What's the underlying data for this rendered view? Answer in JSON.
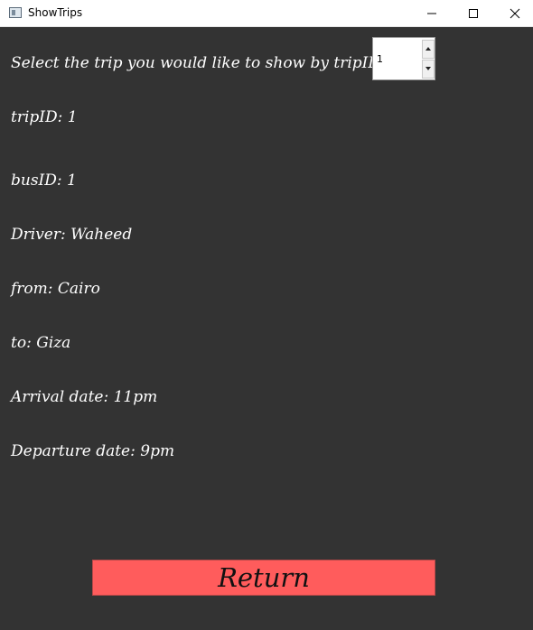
{
  "window": {
    "title": "ShowTrips",
    "icon": "app-window-icon",
    "controls": [
      "minimize-icon",
      "maximize-icon",
      "close-icon"
    ]
  },
  "selector": {
    "prompt": "Select the trip you would like to show by tripID",
    "value": "1"
  },
  "trip": {
    "tripID": "tripID: 1",
    "busID": "busID: 1",
    "driver": "Driver: Waheed",
    "from": "from: Cairo",
    "to": "to: Giza",
    "arrival": "Arrival date: 11pm",
    "departure": "Departure date: 9pm"
  },
  "actions": {
    "return_label": "Return"
  },
  "colors": {
    "background": "#333333",
    "text": "#ffffff",
    "return_button": "#ff5c5c"
  }
}
